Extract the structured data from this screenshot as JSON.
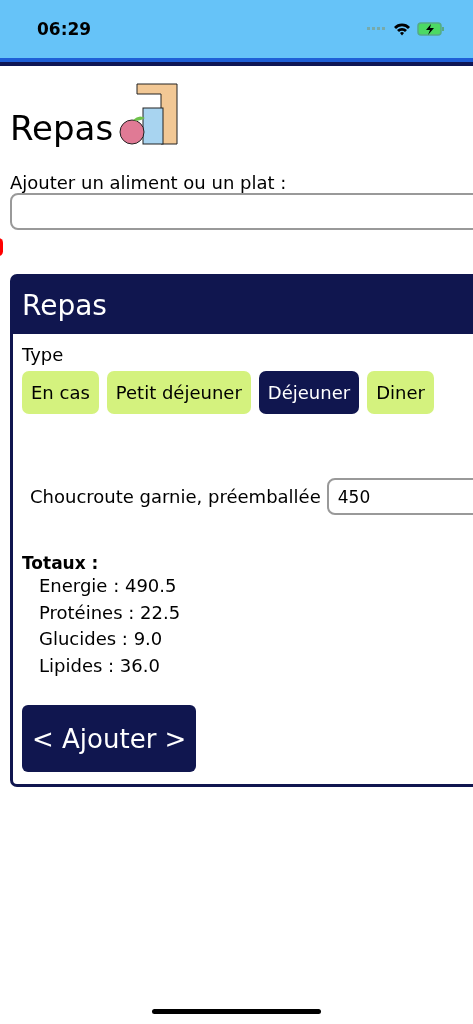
{
  "status_bar": {
    "time": "06:29"
  },
  "title": "Repas",
  "search": {
    "label": "Ajouter un aliment ou un plat :"
  },
  "meal": {
    "title": "Repas",
    "type_label": "Type",
    "types": [
      {
        "label": "En cas",
        "selected": false
      },
      {
        "label": "Petit déjeuner",
        "selected": false
      },
      {
        "label": "Déjeuner",
        "selected": true
      },
      {
        "label": "Diner",
        "selected": false
      }
    ],
    "items": [
      {
        "name": "Choucroute garnie, préemballée",
        "quantity": "450"
      }
    ],
    "totals_label": "Totaux :",
    "totals": [
      "Energie : 490.5",
      "Protéines : 22.5",
      "Glucides : 9.0",
      "Lipides : 36.0"
    ],
    "add_button": "< Ajouter >"
  }
}
